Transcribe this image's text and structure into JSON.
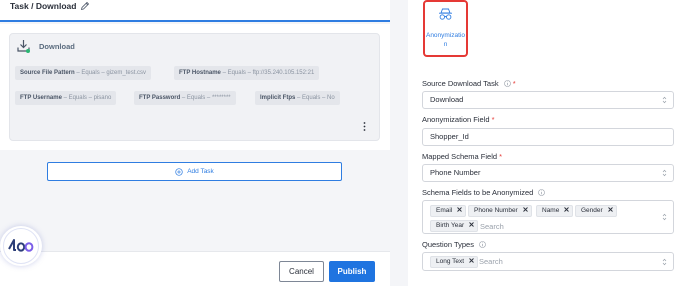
{
  "task": {
    "title": "Task / Download",
    "download_label": "Download",
    "params": [
      {
        "key": "Source File Pattern",
        "value": " – Equals – gizem_test.csv"
      },
      {
        "key": "FTP Hostname",
        "value": " – Equals – ftp://35.240.105.152:21"
      },
      {
        "key": "FTP Username",
        "value": " – Equals – pisano"
      },
      {
        "key": "FTP Password",
        "value": " – Equals – ********"
      },
      {
        "key": "Implicit Ftps",
        "value": " – Equals – No"
      }
    ],
    "add_task_label": "Add Task"
  },
  "footer": {
    "cancel_label": "Cancel",
    "publish_label": "Publish"
  },
  "config": {
    "anon_tile_label": "Anonymization",
    "source_task": {
      "label": "Source Download Task",
      "value": "Download"
    },
    "anon_field": {
      "label": "Anonymization Field",
      "value": "Shopper_Id"
    },
    "mapped_field": {
      "label": "Mapped Schema Field",
      "value": "Phone Number"
    },
    "schema_fields": {
      "label": "Schema Fields to be Anonymized",
      "tags": [
        "Email",
        "Phone Number",
        "Name",
        "Gender",
        "Birth Year"
      ],
      "placeholder": "Search"
    },
    "question_types": {
      "label": "Question Types",
      "tags": [
        "Long Text"
      ],
      "placeholder": "Search"
    }
  },
  "colors": {
    "accent": "#2f7de1",
    "publish": "#1f74e0",
    "required": "#e53935",
    "highlight_border": "#e53935"
  },
  "icons": [
    "pencil-icon",
    "download-icon",
    "kebab-menu-icon",
    "plus-circle-icon",
    "incognito-icon",
    "info-icon",
    "sort-updown-icon",
    "close-x-icon",
    "leo-logo"
  ]
}
